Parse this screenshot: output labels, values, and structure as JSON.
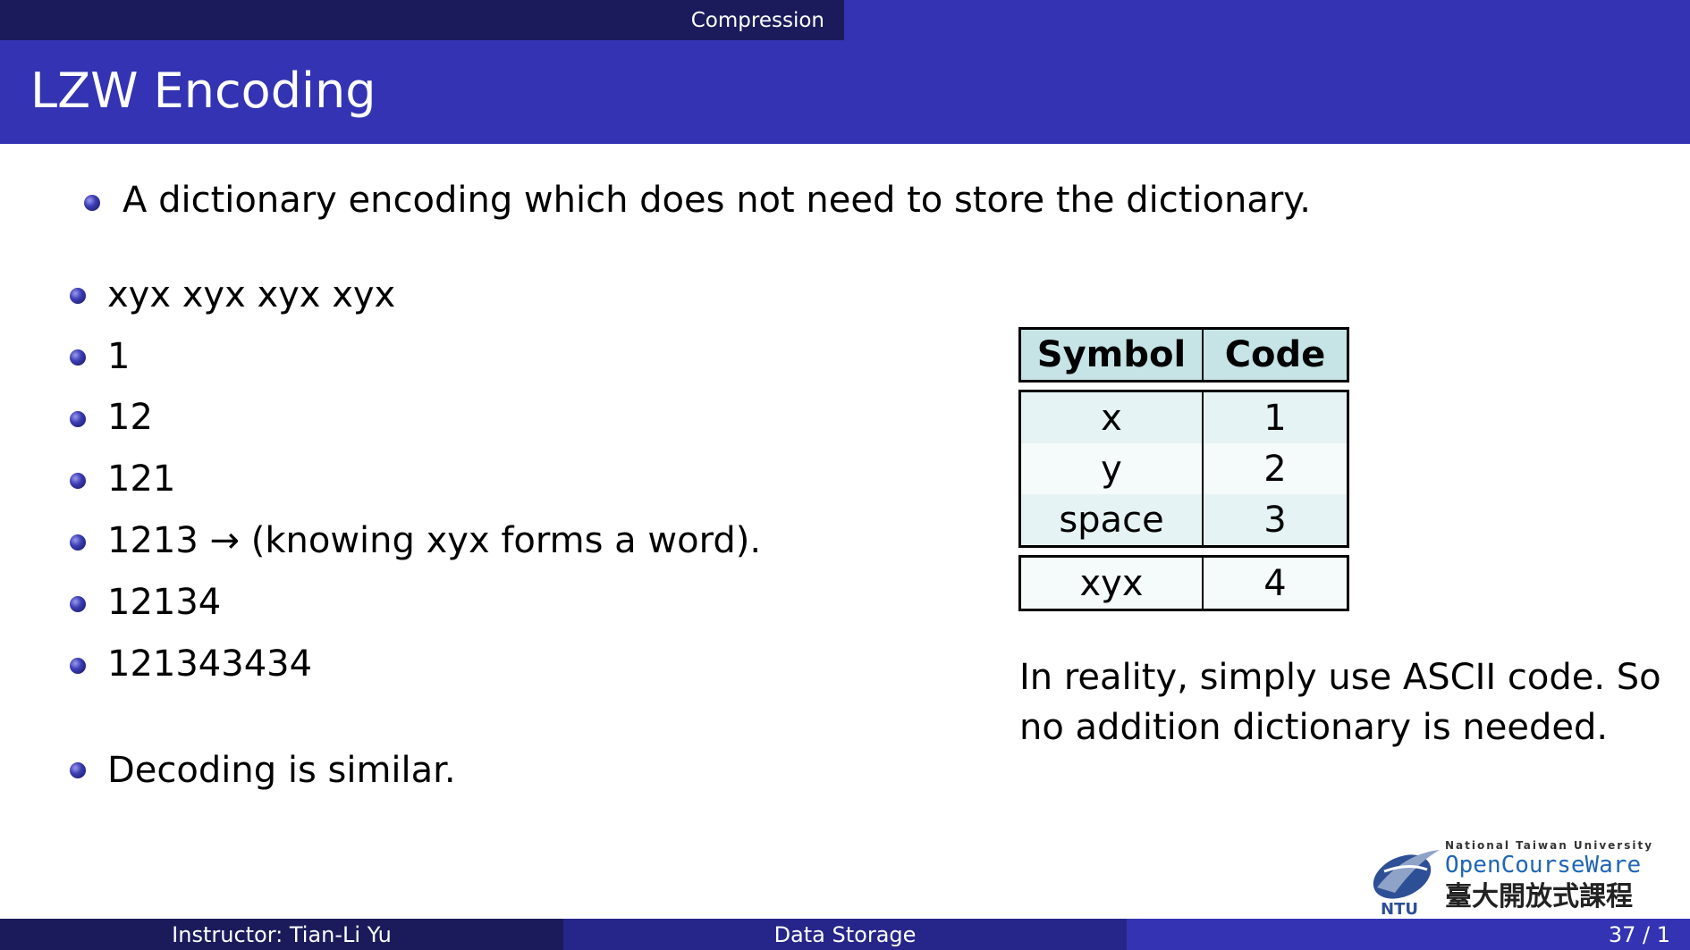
{
  "header": {
    "section": "Compression"
  },
  "slide": {
    "title": "LZW Encoding"
  },
  "intro": "A dictionary encoding which does not need to store the dictionary.",
  "steps": [
    "xyx xyx xyx xyx",
    "1",
    "12",
    "121",
    "1213 → (knowing xyx forms a word).",
    "12134",
    "121343434"
  ],
  "closing": "Decoding is similar.",
  "table": {
    "headers": [
      "Symbol",
      "Code"
    ],
    "rows": [
      [
        "x",
        "1"
      ],
      [
        "y",
        "2"
      ],
      [
        "space",
        "3"
      ]
    ],
    "extra_row": [
      "xyx",
      "4"
    ]
  },
  "note": "In reality, simply use ASCII code. So no addition dictionary is needed.",
  "logo": {
    "line1": "National Taiwan University",
    "line2": "OpenCourseWare",
    "line3": "臺大開放式課程",
    "badge": "NTU"
  },
  "footer": {
    "instructor": "Instructor: Tian-Li Yu",
    "course": "Data Storage",
    "page": "37 / 1"
  },
  "colors": {
    "dark_navy": "#1b1b5c",
    "banner_blue": "#3333b3",
    "table_header": "#c6e4e6"
  }
}
